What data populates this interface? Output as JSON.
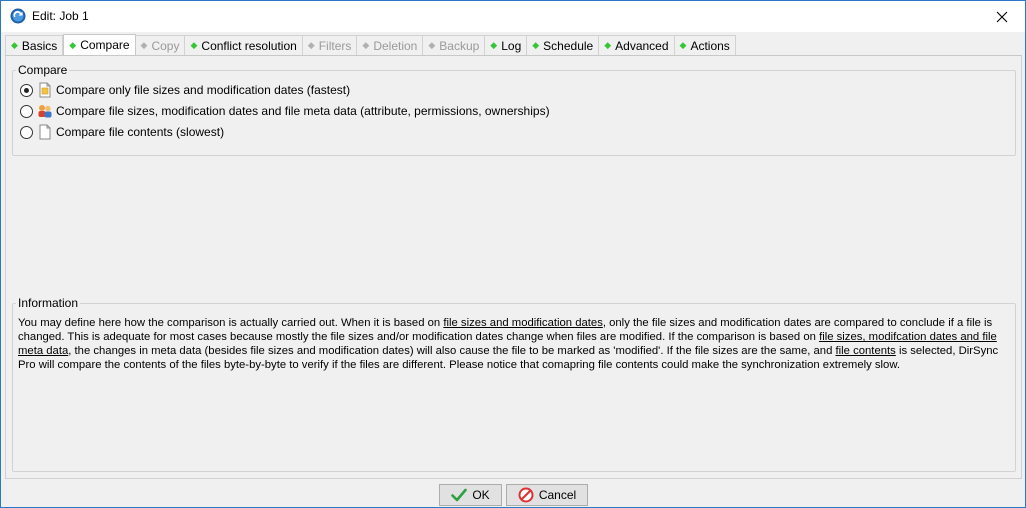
{
  "window": {
    "title": "Edit: Job 1"
  },
  "tabs": [
    {
      "label": "Basics",
      "state": "normal",
      "dot": "green"
    },
    {
      "label": "Compare",
      "state": "active",
      "dot": "green"
    },
    {
      "label": "Copy",
      "state": "disabled",
      "dot": "gray"
    },
    {
      "label": "Conflict resolution",
      "state": "normal",
      "dot": "green"
    },
    {
      "label": "Filters",
      "state": "disabled",
      "dot": "gray"
    },
    {
      "label": "Deletion",
      "state": "disabled",
      "dot": "gray"
    },
    {
      "label": "Backup",
      "state": "disabled",
      "dot": "gray"
    },
    {
      "label": "Log",
      "state": "normal",
      "dot": "green"
    },
    {
      "label": "Schedule",
      "state": "normal",
      "dot": "green"
    },
    {
      "label": "Advanced",
      "state": "normal",
      "dot": "green"
    },
    {
      "label": "Actions",
      "state": "normal",
      "dot": "green"
    }
  ],
  "compare": {
    "title": "Compare",
    "options": [
      {
        "label": "Compare only file sizes and modification dates (fastest)",
        "selected": true
      },
      {
        "label": "Compare file sizes, modification dates and file meta data (attribute, permissions, ownerships)",
        "selected": false
      },
      {
        "label": "Compare file contents (slowest)",
        "selected": false
      }
    ]
  },
  "info": {
    "title": "Information",
    "parts": [
      "You may define here how the comparison is actually carried out. When it is based on ",
      "file sizes and modification dates",
      ", only the file sizes and modification dates are compared to conclude if a file is changed. This is adequate for most cases because mostly the file sizes and/or modification dates change when files are modified. If the comparison is based on ",
      "file sizes, modifcation dates and file meta data",
      ", the changes in meta data (besides file sizes and modification dates) will also cause the file to be marked as 'modified'. If the file sizes are the same, and ",
      "file contents",
      " is selected, DirSync Pro will compare the contents of the files byte-by-byte to verify if the files are different. Please notice that comapring file contents could make the synchronization extremely slow."
    ]
  },
  "buttons": {
    "ok": "OK",
    "cancel": "Cancel"
  },
  "colors": {
    "window_border": "#2b78c6",
    "tab_dot_green": "#36c636",
    "ok_check": "#2ea043",
    "cancel_icon": "#e03131"
  }
}
